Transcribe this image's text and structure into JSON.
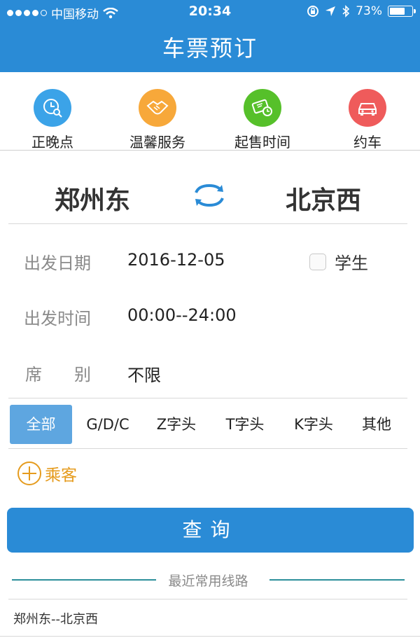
{
  "status_bar": {
    "carrier": "中国移动",
    "time": "20:34",
    "battery_text": "73%",
    "battery_level": 0.73
  },
  "header": {
    "title": "车票预订"
  },
  "quick_links": [
    {
      "label": "正晚点",
      "icon": "clock-search-icon",
      "color": "#3ba3e8"
    },
    {
      "label": "温馨服务",
      "icon": "handshake-icon",
      "color": "#f7a83a"
    },
    {
      "label": "起售时间",
      "icon": "ticket-clock-icon",
      "color": "#56c02a"
    },
    {
      "label": "约车",
      "icon": "car-icon",
      "color": "#ef5b5b"
    }
  ],
  "route": {
    "from": "郑州东",
    "to": "北京西"
  },
  "form": {
    "date_label": "出发日期",
    "date_value": "2016-12-05",
    "student_label": "学生",
    "time_label": "出发时间",
    "time_value": "00:00--24:00",
    "seat_label_1": "席",
    "seat_label_2": "别",
    "seat_value": "不限"
  },
  "filters": [
    "全部",
    "G/D/C",
    "Z字头",
    "T字头",
    "K字头",
    "其他"
  ],
  "passenger_label": "乘客",
  "search_button": "查询",
  "recent": {
    "title": "最近常用线路",
    "items": [
      "郑州东--北京西"
    ]
  },
  "colors": {
    "primary": "#2a8bd6",
    "active_chip": "#5ea6e0",
    "accent_orange": "#e59b1d",
    "divider_teal": "#2c8f9b"
  }
}
